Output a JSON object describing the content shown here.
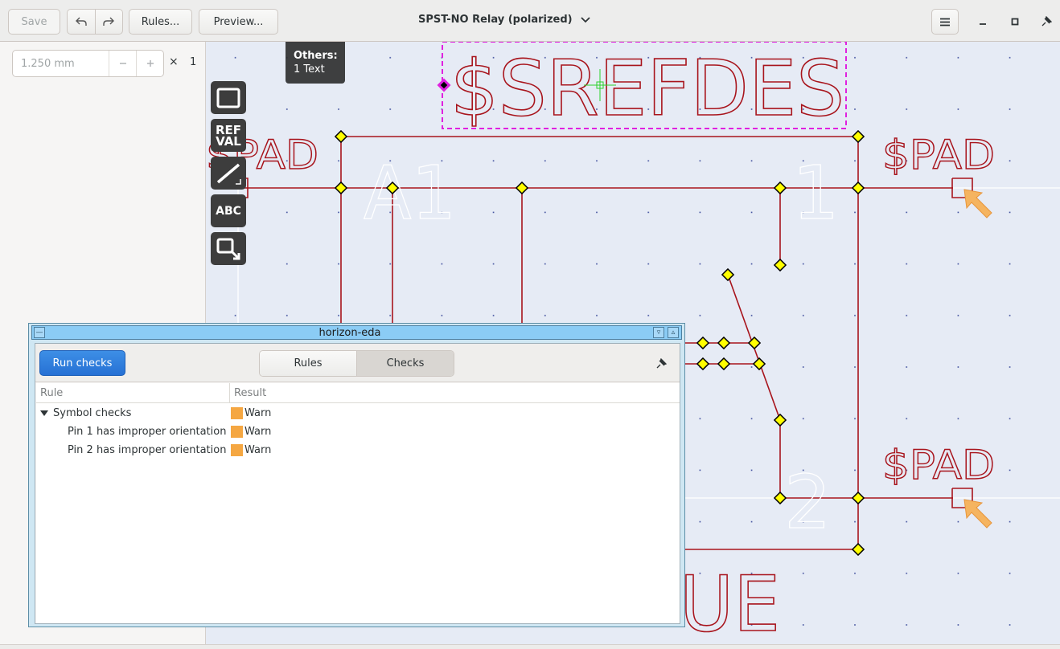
{
  "header": {
    "save_label": "Save",
    "rules_label": "Rules...",
    "preview_label": "Preview...",
    "title": "SPST-NO Relay (polarized)"
  },
  "sidebar": {
    "grid_value": "1.250 mm",
    "multiplier_symbol": "×",
    "multiplier_value": "1"
  },
  "canvas": {
    "refdes": "$SREFDES",
    "pad_left": "$PAD",
    "pad_top_right": "$PAD",
    "pad_bottom_right": "$PAD",
    "pin_a1": "A1",
    "pin_1": "1",
    "pin_2": "2",
    "value_partial": "UE",
    "colors": {
      "background": "#e6ebf5",
      "stroke": "#a8141c",
      "pins": "#ffffff",
      "selection": "#e020e0",
      "junction": "#ffff00"
    }
  },
  "tooltip": {
    "title": "Others:",
    "detail": "1 Text"
  },
  "tools": {
    "refval_line1": "REF",
    "refval_line2": "VAL",
    "abc": "ABC"
  },
  "dialog": {
    "window_title": "horizon-eda",
    "run_button": "Run checks",
    "tab_rules": "Rules",
    "tab_checks": "Checks",
    "col_rule": "Rule",
    "col_result": "Result",
    "rows": [
      {
        "rule": "Symbol checks",
        "result": "Warn"
      },
      {
        "rule": "Pin 1 has improper orientation",
        "result": "Warn"
      },
      {
        "rule": "Pin 2 has improper orientation",
        "result": "Warn"
      }
    ],
    "warn_color": "#f5a742"
  }
}
